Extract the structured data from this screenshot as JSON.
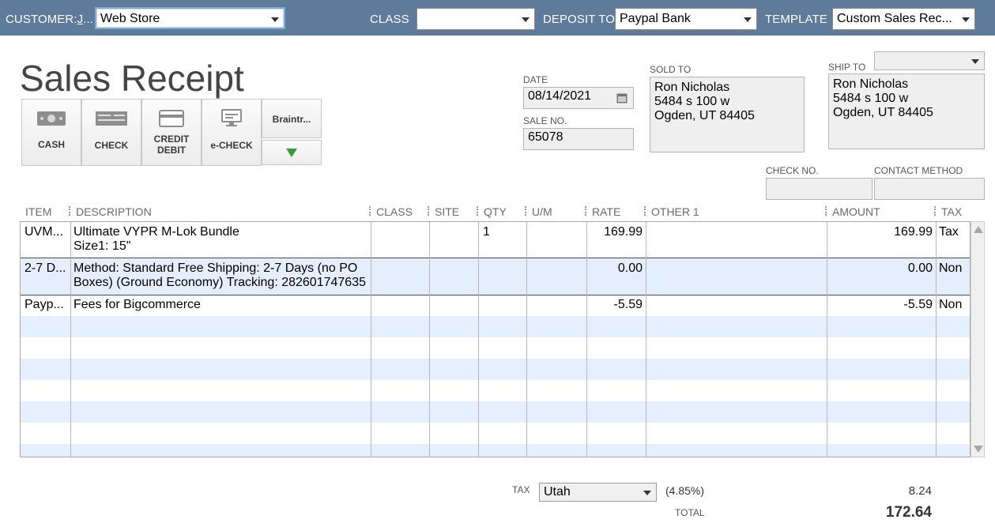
{
  "header": {
    "customer_label_pre": "CUSTOMER:",
    "customer_label_key": "J",
    "customer_label_post": "...",
    "customer_value": "Web Store",
    "class_label": "CLASS",
    "class_value": "",
    "deposit_label": "DEPOSIT TO",
    "deposit_value": "Paypal Bank",
    "template_label": "TEMPLATE",
    "template_value": "Custom Sales Rec..."
  },
  "form_title": "Sales Receipt",
  "payment_methods": {
    "cash": "CASH",
    "check": "CHECK",
    "credit_line1": "CREDIT",
    "credit_line2": "DEBIT",
    "echeck": "e-CHECK",
    "braintree": "Braintr..."
  },
  "date": {
    "label": "DATE",
    "value": "08/14/2021"
  },
  "sale_no": {
    "label": "SALE NO.",
    "value": "65078"
  },
  "sold_to": {
    "label": "SOLD TO",
    "line1": "Ron Nicholas",
    "line2": "5484 s 100 w",
    "line3": "Ogden, UT 84405"
  },
  "ship_to": {
    "label": "SHIP TO",
    "dropdown_value": "",
    "line1": "Ron Nicholas",
    "line2": "5484 s 100 w",
    "line3": "Ogden, UT 84405"
  },
  "check_no": {
    "label": "CHECK NO.",
    "value": ""
  },
  "contact_method": {
    "label": "CONTACT METHOD",
    "value": ""
  },
  "columns": [
    "ITEM",
    "DESCRIPTION",
    "CLASS",
    "SITE",
    "QTY",
    "U/M",
    "RATE",
    "OTHER 1",
    "AMOUNT",
    "TAX"
  ],
  "rows": [
    {
      "item": "UVM...",
      "desc1": "Ultimate VYPR M-Lok Bundle",
      "desc2": "Size1: 15\"",
      "qty": "1",
      "rate": "169.99",
      "amount": "169.99",
      "tax": "Tax"
    },
    {
      "item": "2-7 D...",
      "desc1": "Method: Standard Free Shipping: 2-7 Days (no PO",
      "desc2": "Boxes) (Ground Economy) Tracking: 282601747635",
      "qty": "",
      "rate": "0.00",
      "amount": "0.00",
      "tax": "Non"
    },
    {
      "item": "Payp...",
      "desc1": "Fees for Bigcommerce",
      "desc2": "",
      "qty": "",
      "rate": "-5.59",
      "amount": "-5.59",
      "tax": "Non"
    }
  ],
  "footer": {
    "tax_label": "TAX",
    "tax_value": "Utah",
    "tax_rate": "(4.85%)",
    "tax_amount": "8.24",
    "total_label": "TOTAL",
    "total_value": "172.64"
  },
  "colors": {
    "header_bar": "#5f7b9b",
    "stripe": "#e5efff",
    "green_arrow": "#3f9a3f"
  }
}
